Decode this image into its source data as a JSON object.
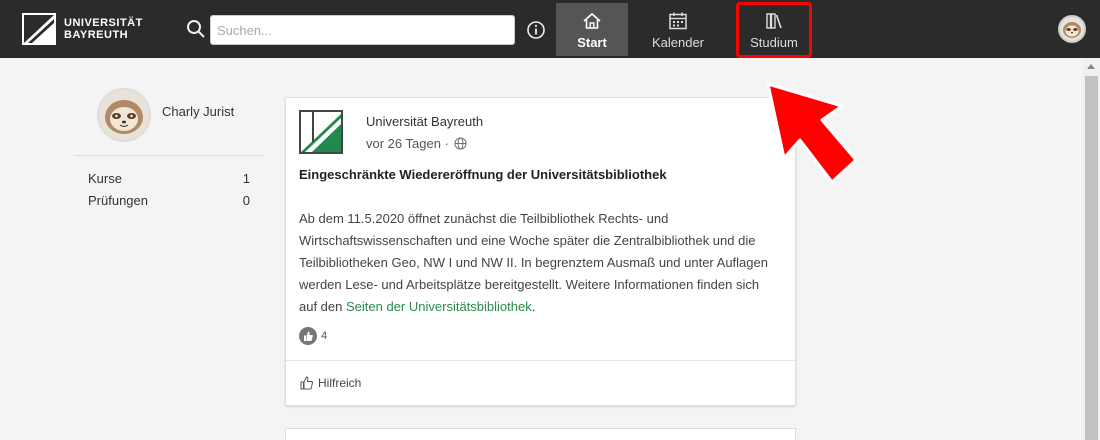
{
  "header": {
    "logo_line1": "UNIVERSITÄT",
    "logo_line2": "BAYREUTH",
    "search_placeholder": "Suchen...",
    "nav": [
      {
        "label": "Start",
        "icon": "home-icon",
        "active": true
      },
      {
        "label": "Kalender",
        "icon": "calendar-icon",
        "active": false
      },
      {
        "label": "Studium",
        "icon": "books-icon",
        "active": false,
        "highlighted": true
      }
    ]
  },
  "profile": {
    "name": "Charly Jurist",
    "stats": [
      {
        "label": "Kurse",
        "value": "1"
      },
      {
        "label": "Prüfungen",
        "value": "0"
      }
    ]
  },
  "post": {
    "author": "Universität Bayreuth",
    "time": "vor 26 Tagen ·",
    "title": "Eingeschränkte Wiedereröffnung der Universitätsbibliothek",
    "body": "Ab dem 11.5.2020 öffnet zunächst die Teilbibliothek Rechts- und Wirtschaftswissenschaften und eine Woche später die Zentralbibliothek und die Teilbibliotheken Geo, NW I und NW II. In begrenztem Ausmaß und unter Auflagen werden Lese- und Arbeitsplätze bereitgestellt. Weitere Informationen finden sich auf den ",
    "link_text": "Seiten der Universitätsbibliothek",
    "body_end": ".",
    "reaction_count": "4",
    "helpful_label": "Hilfreich"
  },
  "colors": {
    "header_bg": "#2b2b2b",
    "accent_green": "#2a8a4a",
    "highlight_red": "#ff0000"
  }
}
